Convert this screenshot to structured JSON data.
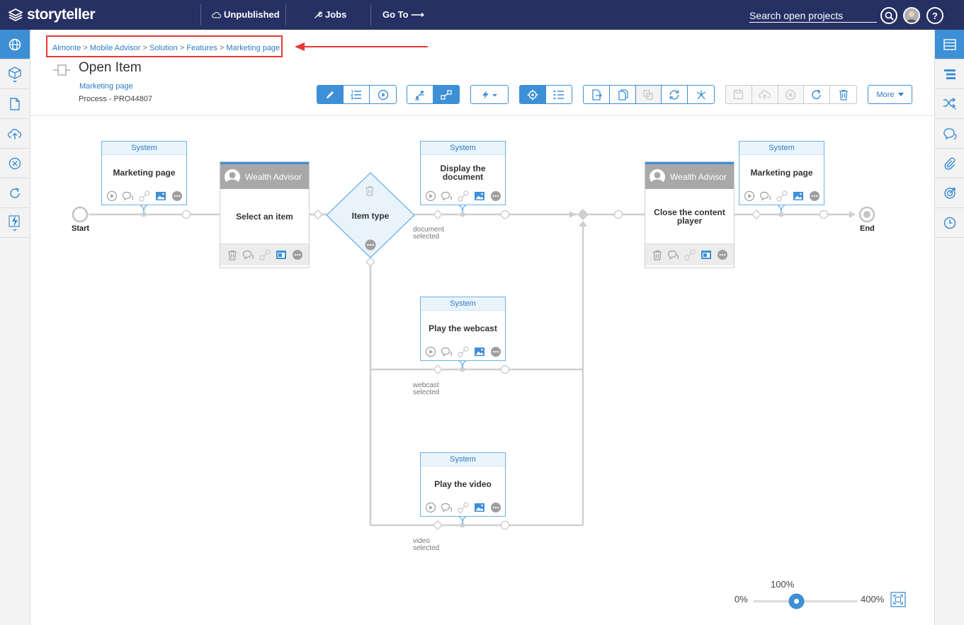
{
  "topbar": {
    "logo": "storyteller",
    "status": "Unpublished",
    "jobs": "Jobs",
    "goto": "Go To ⟶",
    "search_placeholder": "Search open projects",
    "help": "?"
  },
  "left_sidebar": [
    "globe-icon",
    "cube-icon",
    "document-icon",
    "cloud-upload-icon",
    "close-circle-icon",
    "refresh-icon",
    "lightning-icon"
  ],
  "right_sidebar": [
    "list-icon",
    "outline-icon",
    "shuffle-icon",
    "comments-icon",
    "paperclip-icon",
    "target-icon",
    "clock-icon"
  ],
  "breadcrumb": [
    "Almonte",
    "Mobile Advisor",
    "Solution",
    "Features",
    "Marketing page"
  ],
  "breadcrumb_sep": ">",
  "header": {
    "title": "Open Item",
    "link": "Marketing page",
    "process": "Process - PRO44807"
  },
  "toolbar": {
    "more_label": "More"
  },
  "diagram": {
    "start_label": "Start",
    "end_label": "End",
    "nodes": {
      "marketing1": {
        "header": "System",
        "label": "Marketing page"
      },
      "select": {
        "role": "Wealth Advisor",
        "label": "Select an item"
      },
      "decision": {
        "label": "Item type"
      },
      "display": {
        "header": "System",
        "label": "Display the document"
      },
      "webcast": {
        "header": "System",
        "label": "Play the webcast"
      },
      "video": {
        "header": "System",
        "label": "Play the video"
      },
      "close": {
        "role": "Wealth Advisor",
        "label": "Close the content player"
      },
      "marketing2": {
        "header": "System",
        "label": "Marketing page"
      }
    },
    "branch_labels": {
      "document_1": "document",
      "document_2": "selected",
      "webcast_1": "webcast",
      "webcast_2": "selected",
      "video_1": "video",
      "video_2": "selected"
    }
  },
  "zoom": {
    "min_label": "0%",
    "max_label": "400%",
    "current_label": "100%",
    "current_value": 100
  },
  "colors": {
    "topbar": "#263063",
    "accent": "#3d8fd6",
    "highlight_box": "#e53935"
  }
}
